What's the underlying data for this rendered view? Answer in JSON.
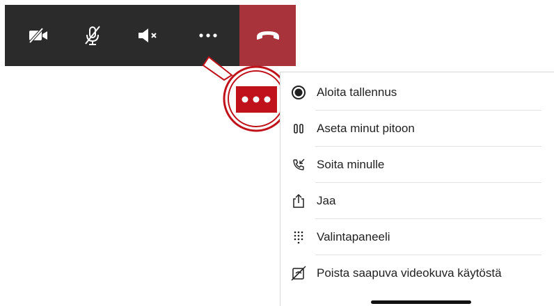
{
  "toolbar": {
    "buttons": [
      {
        "name": "camera-off-icon"
      },
      {
        "name": "mic-off-icon"
      },
      {
        "name": "speaker-muted-icon"
      },
      {
        "name": "more-icon"
      }
    ],
    "hangup": {
      "name": "hang-up-icon",
      "color": "#a8333a"
    },
    "background": "#2b2b2b"
  },
  "highlight": {
    "color": "#c0121a",
    "icon": "more-icon"
  },
  "menu": {
    "items": [
      {
        "icon": "record-icon",
        "label": "Aloita tallennus"
      },
      {
        "icon": "hold-icon",
        "label": "Aseta minut pitoon"
      },
      {
        "icon": "call-me-icon",
        "label": "Soita minulle"
      },
      {
        "icon": "share-icon",
        "label": "Jaa"
      },
      {
        "icon": "dialpad-icon",
        "label": "Valintapaneeli"
      },
      {
        "icon": "video-off-icon",
        "label": "Poista saapuva videokuva käytöstä"
      }
    ]
  }
}
